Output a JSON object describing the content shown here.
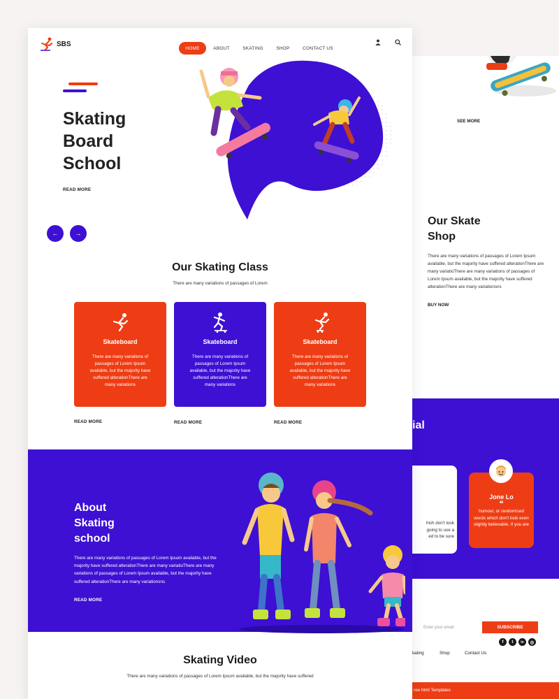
{
  "nav": {
    "logo": "SBS",
    "items": [
      "HOME",
      "ABOUT",
      "SKATING",
      "SHOP",
      "CONTACT US"
    ]
  },
  "hero": {
    "title_lines": [
      "Skating",
      "Board",
      "School"
    ],
    "read_more": "READ MORE",
    "prev": "←",
    "next": "→"
  },
  "classes": {
    "title": "Our Skating Class",
    "subtitle": "There are many variations of passages of Lorem",
    "cards": [
      {
        "title": "Skateboard",
        "text": "There are many variations of passages of Lorem Ipsum available, but the majority have suffered alterationThere are many variations",
        "color": "#ee3d14",
        "read_more": "READ MORE"
      },
      {
        "title": "Skateboard",
        "text": "There are many variations of passages of Lorem Ipsum available, but the majority have suffered alterationThere are many variations",
        "color": "#3d10d4",
        "read_more": "READ MORE"
      },
      {
        "title": "Skateboard",
        "text": "There are many variations of passages of Lorem Ipsum available, but the majority have suffered alterationThere are many variations",
        "color": "#ee3d14",
        "read_more": "READ MORE"
      }
    ]
  },
  "about": {
    "title_lines": [
      "About",
      "Skating",
      "school"
    ],
    "text": "There are many variations of passages of Lorem Ipsum available, but the majority have suffered alterationThere are many variatioThere are many variations of passages of Lorem Ipsum available, but the majority have suffered alterationThere are many variationsns",
    "read_more": "READ MORE"
  },
  "video": {
    "title": "Skating Video",
    "subtitle": "There are many variations of passages of Lorem Ipsum available, but the majority have suffered"
  },
  "back_page": {
    "see_more": "SEE MORE",
    "shop_title_lines": [
      "Our Skate",
      "Shop"
    ],
    "shop_text": "There are many variations of passages of Lorem Ipsum available, but the majority have suffered alterationThere are many variatioThere are many variations of passages of Lorem Ipsum available, but the majority have suffered alterationThere are many variationsns",
    "buy_now": "BUY NOW",
    "testimonial_fragment": "ial",
    "testimonial_left_text": "hich don't look\ngoing to use a\ned to be sure",
    "testimonial_name": "Jone Lo",
    "quote_mark": "❝",
    "testimonial_text": "humour, or randomised words which don't look even slightly believable. If you are",
    "email_placeholder": "Enter your email",
    "subscribe": "SUBSCRIBE",
    "footer_links": [
      "kating",
      "Shop",
      "Contact Us"
    ],
    "footer_bar_text": "ree html Templates",
    "social_icons": [
      "facebook-icon",
      "twitter-icon",
      "linkedin-icon",
      "instagram-icon"
    ],
    "social_glyphs": [
      "f",
      "t",
      "in",
      "◎"
    ]
  },
  "colors": {
    "accent": "#ee3d14",
    "brand": "#3d10d4"
  }
}
